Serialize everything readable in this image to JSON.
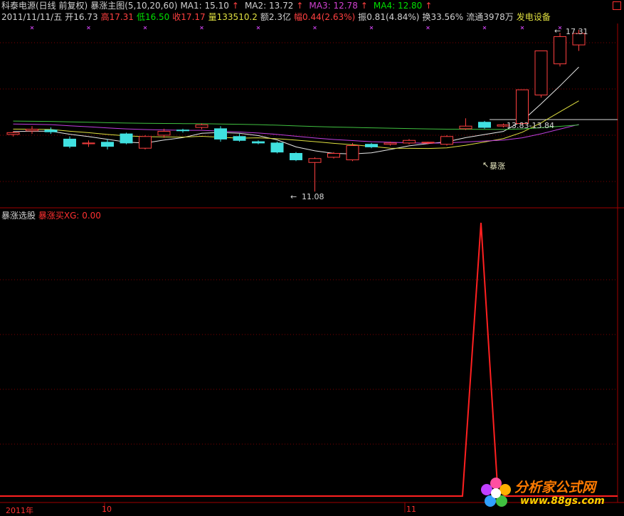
{
  "header": {
    "title": "科泰电源(日线 前复权)",
    "indicator": "暴涨主图(5,10,20,60)",
    "ma1": "MA1: 15.10",
    "ma2": "MA2: 13.72",
    "ma3": "MA3: 12.78",
    "ma4": "MA4: 12.80",
    "arrow": "↑"
  },
  "quote": {
    "date": "2011/11/11/五",
    "open": "开16.73",
    "high": "高17.31",
    "low": "低16.50",
    "close": "收17.17",
    "volume": "量133510.2",
    "amount": "额2.3亿",
    "change": "幅0.44(2.63%)",
    "amplitude": "振0.81(4.84%)",
    "turnover": "换33.56%",
    "float": "流通3978万",
    "industry": "发电设备"
  },
  "annotations": {
    "high_label": "17.31",
    "low_label": "11.08",
    "range_label": "13.83-13.84",
    "signal_label": "暴涨"
  },
  "sub_panel": {
    "name": "暴涨选股",
    "value_label": "暴涨买XG: 0.00"
  },
  "time_axis": {
    "label_1": "2011年",
    "label_2": "10",
    "label_3": "11"
  },
  "watermark": {
    "cn": "分析家公式网",
    "url": "www.88gs.com"
  },
  "colors": {
    "up": "#ff4040",
    "down": "#40e0e0",
    "ma_white": "#e8e8e8",
    "ma_yellow": "#e0e040",
    "ma_magenta": "#c040e0",
    "ma_green": "#40c040",
    "signal": "#ff2020",
    "grid": "#800000"
  },
  "candles": [
    {
      "o": 13.28,
      "h": 13.4,
      "l": 13.2,
      "c": 13.35
    },
    {
      "o": 13.42,
      "h": 13.6,
      "l": 13.3,
      "c": 13.48
    },
    {
      "o": 13.45,
      "h": 13.55,
      "l": 13.3,
      "c": 13.38
    },
    {
      "o": 13.1,
      "h": 13.2,
      "l": 12.75,
      "c": 12.82
    },
    {
      "o": 12.92,
      "h": 13.05,
      "l": 12.8,
      "c": 12.95
    },
    {
      "o": 12.98,
      "h": 13.1,
      "l": 12.7,
      "c": 12.82
    },
    {
      "o": 13.3,
      "h": 13.35,
      "l": 12.9,
      "c": 12.95
    },
    {
      "o": 12.75,
      "h": 13.25,
      "l": 12.7,
      "c": 13.2
    },
    {
      "o": 13.25,
      "h": 13.5,
      "l": 13.15,
      "c": 13.4
    },
    {
      "o": 13.45,
      "h": 13.5,
      "l": 13.35,
      "c": 13.42
    },
    {
      "o": 13.55,
      "h": 13.7,
      "l": 13.48,
      "c": 13.65
    },
    {
      "o": 13.5,
      "h": 13.6,
      "l": 13.0,
      "c": 13.1
    },
    {
      "o": 13.2,
      "h": 13.3,
      "l": 13.0,
      "c": 13.05
    },
    {
      "o": 13.0,
      "h": 13.05,
      "l": 12.9,
      "c": 12.95
    },
    {
      "o": 12.95,
      "h": 13.0,
      "l": 12.55,
      "c": 12.6
    },
    {
      "o": 12.55,
      "h": 12.6,
      "l": 12.25,
      "c": 12.3
    },
    {
      "o": 12.2,
      "h": 12.4,
      "l": 11.08,
      "c": 12.35
    },
    {
      "o": 12.4,
      "h": 12.6,
      "l": 12.35,
      "c": 12.55
    },
    {
      "o": 12.3,
      "h": 12.95,
      "l": 12.25,
      "c": 12.85
    },
    {
      "o": 12.9,
      "h": 12.95,
      "l": 12.75,
      "c": 12.8
    },
    {
      "o": 12.9,
      "h": 13.0,
      "l": 12.85,
      "c": 12.95
    },
    {
      "o": 12.95,
      "h": 13.1,
      "l": 12.9,
      "c": 13.05
    },
    {
      "o": 12.95,
      "h": 13.0,
      "l": 12.9,
      "c": 12.98
    },
    {
      "o": 12.9,
      "h": 13.25,
      "l": 12.85,
      "c": 13.2
    },
    {
      "o": 13.5,
      "h": 13.9,
      "l": 13.45,
      "c": 13.6
    },
    {
      "o": 13.75,
      "h": 13.8,
      "l": 13.5,
      "c": 13.55
    },
    {
      "o": 13.6,
      "h": 13.7,
      "l": 13.55,
      "c": 13.65
    },
    {
      "o": 13.7,
      "h": 15.0,
      "l": 13.65,
      "c": 15.0
    },
    {
      "o": 14.8,
      "h": 16.5,
      "l": 14.7,
      "c": 16.5
    },
    {
      "o": 16.0,
      "h": 17.2,
      "l": 15.9,
      "c": 17.05
    },
    {
      "o": 16.73,
      "h": 17.31,
      "l": 16.5,
      "c": 17.17
    }
  ]
}
